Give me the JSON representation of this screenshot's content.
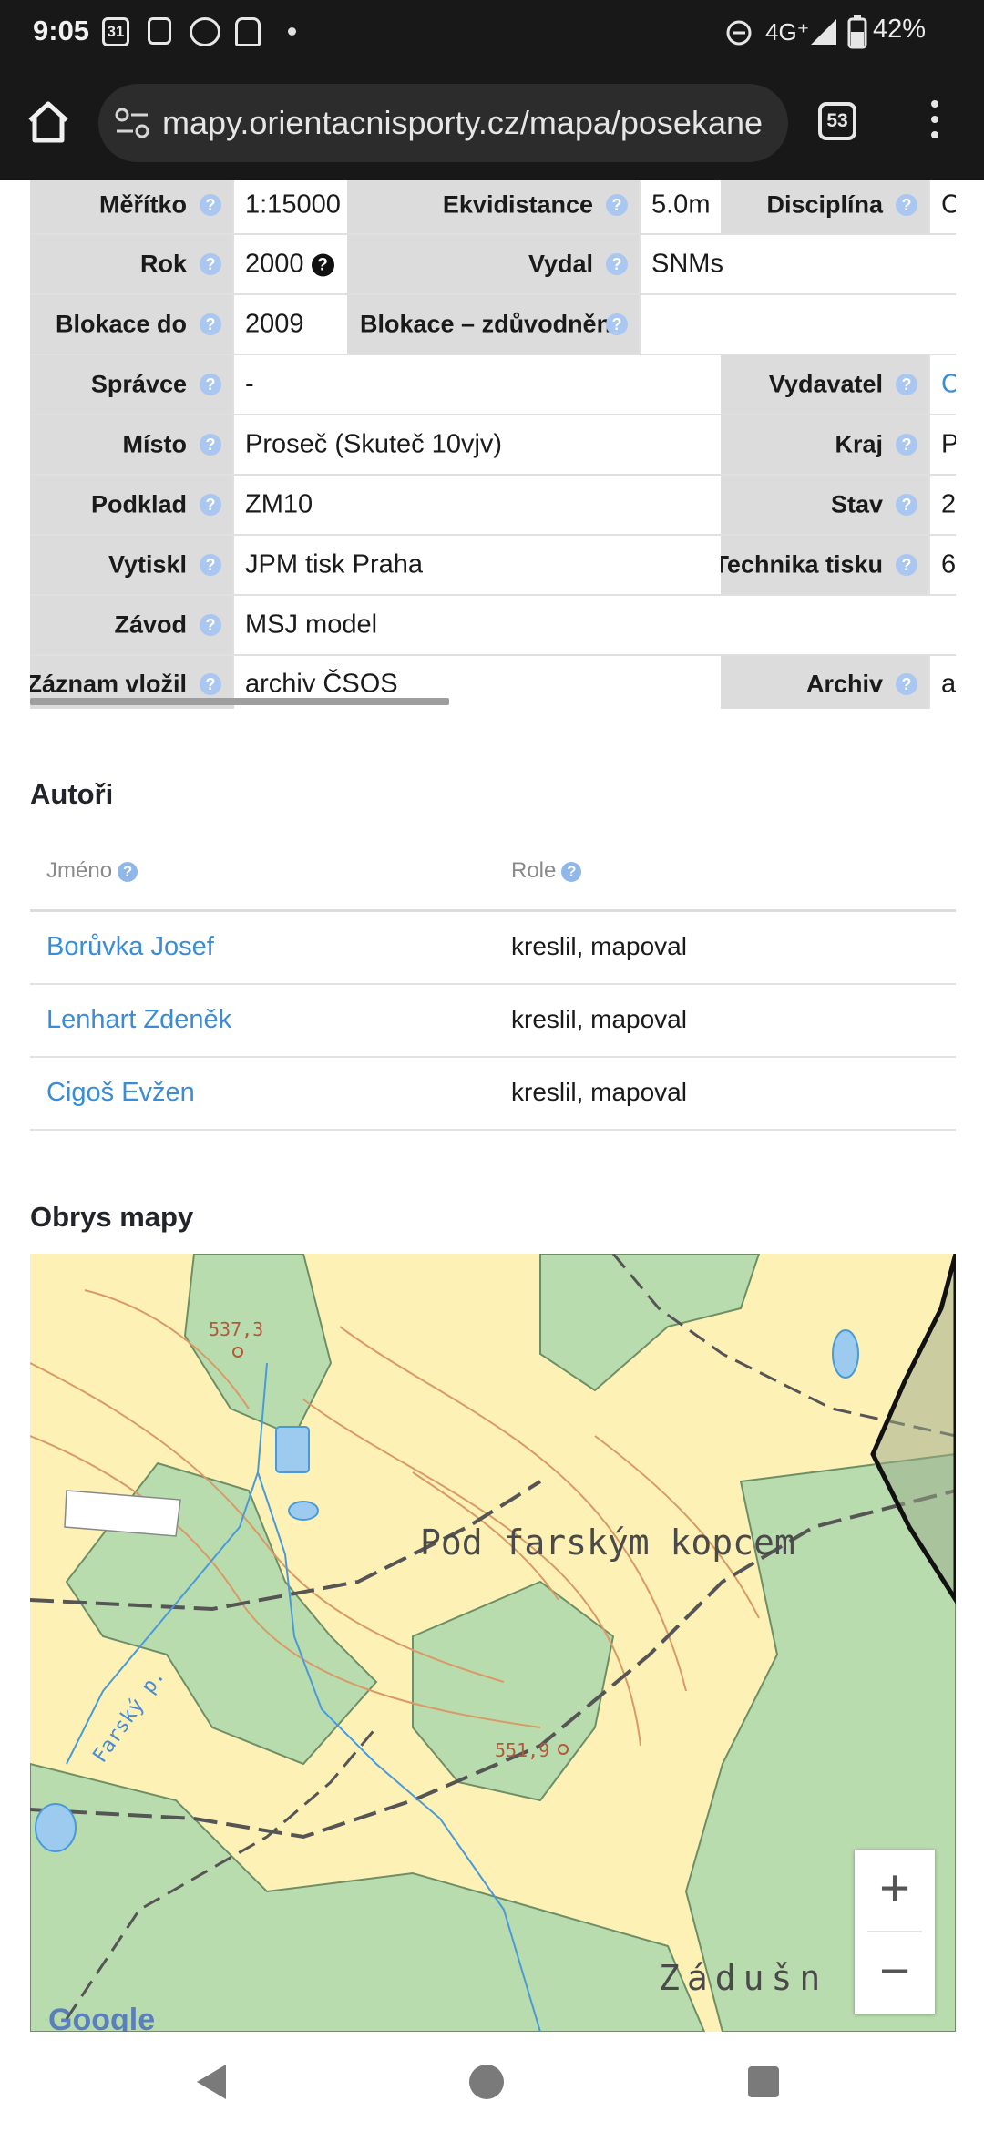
{
  "status_bar": {
    "time": "9:05",
    "calendar_date": "31",
    "network": "4G⁺",
    "battery": "42%"
  },
  "browser": {
    "url": "mapy.orientacnisporty.cz/mapa/posekane",
    "tab_count": "53"
  },
  "info_table": {
    "meritko_label": "Měřítko",
    "meritko_value": "1:15000",
    "ekvidistance_label": "Ekvidistance",
    "ekvidistance_value": "5.0m",
    "disciplina_label": "Disciplína",
    "disciplina_value": "C",
    "rok_label": "Rok",
    "rok_value": "2000",
    "rok_help": "?",
    "vydal_label": "Vydal",
    "vydal_value": "SNMs",
    "blokace_do_label": "Blokace do",
    "blokace_do_value": "2009",
    "blokace_zduvodneni_label": "Blokace – zdůvodnění",
    "blokace_zduvodneni_value": "",
    "spravce_label": "Správce",
    "spravce_value": "-",
    "vydavatel_label": "Vydavatel",
    "vydavatel_value": "C",
    "misto_label": "Místo",
    "misto_value": "Proseč (Skuteč 10vjv)",
    "kraj_label": "Kraj",
    "kraj_value": "P",
    "podklad_label": "Podklad",
    "podklad_value": "ZM10",
    "stav_label": "Stav",
    "stav_value": "2",
    "vytiskl_label": "Vytiskl",
    "vytiskl_value": "JPM tisk Praha",
    "technika_label": "Technika tisku",
    "technika_value": "6",
    "zavod_label": "Závod",
    "zavod_value": "MSJ model",
    "zaznam_label": "Záznam vložil",
    "zaznam_value": "archiv ČSOS",
    "archiv_label": "Archiv",
    "archiv_value": "a"
  },
  "authors": {
    "title": "Autoři",
    "col_name": "Jméno",
    "col_role": "Role",
    "rows": [
      {
        "name": "Borůvka Josef",
        "role": "kreslil, mapoval"
      },
      {
        "name": "Lenhart Zdeněk",
        "role": "kreslil, mapoval"
      },
      {
        "name": "Cigoš Evžen",
        "role": "kreslil, mapoval"
      }
    ]
  },
  "map_section": {
    "title": "Obrys mapy",
    "place_label_1": "Pod farským kopcem",
    "place_label_2": "Zádušn",
    "stream_label": "Farský p.",
    "spot_height_1": "537,3",
    "spot_height_2": "551,9",
    "zoom_in": "+",
    "zoom_out": "−",
    "attribution": "Google"
  },
  "colors": {
    "link": "#3a8bd8",
    "help_icon": "#a9c7f0",
    "header_cell": "#dcdcdc",
    "map_open": "#fdf1b6",
    "map_forest": "#b9dcae"
  }
}
